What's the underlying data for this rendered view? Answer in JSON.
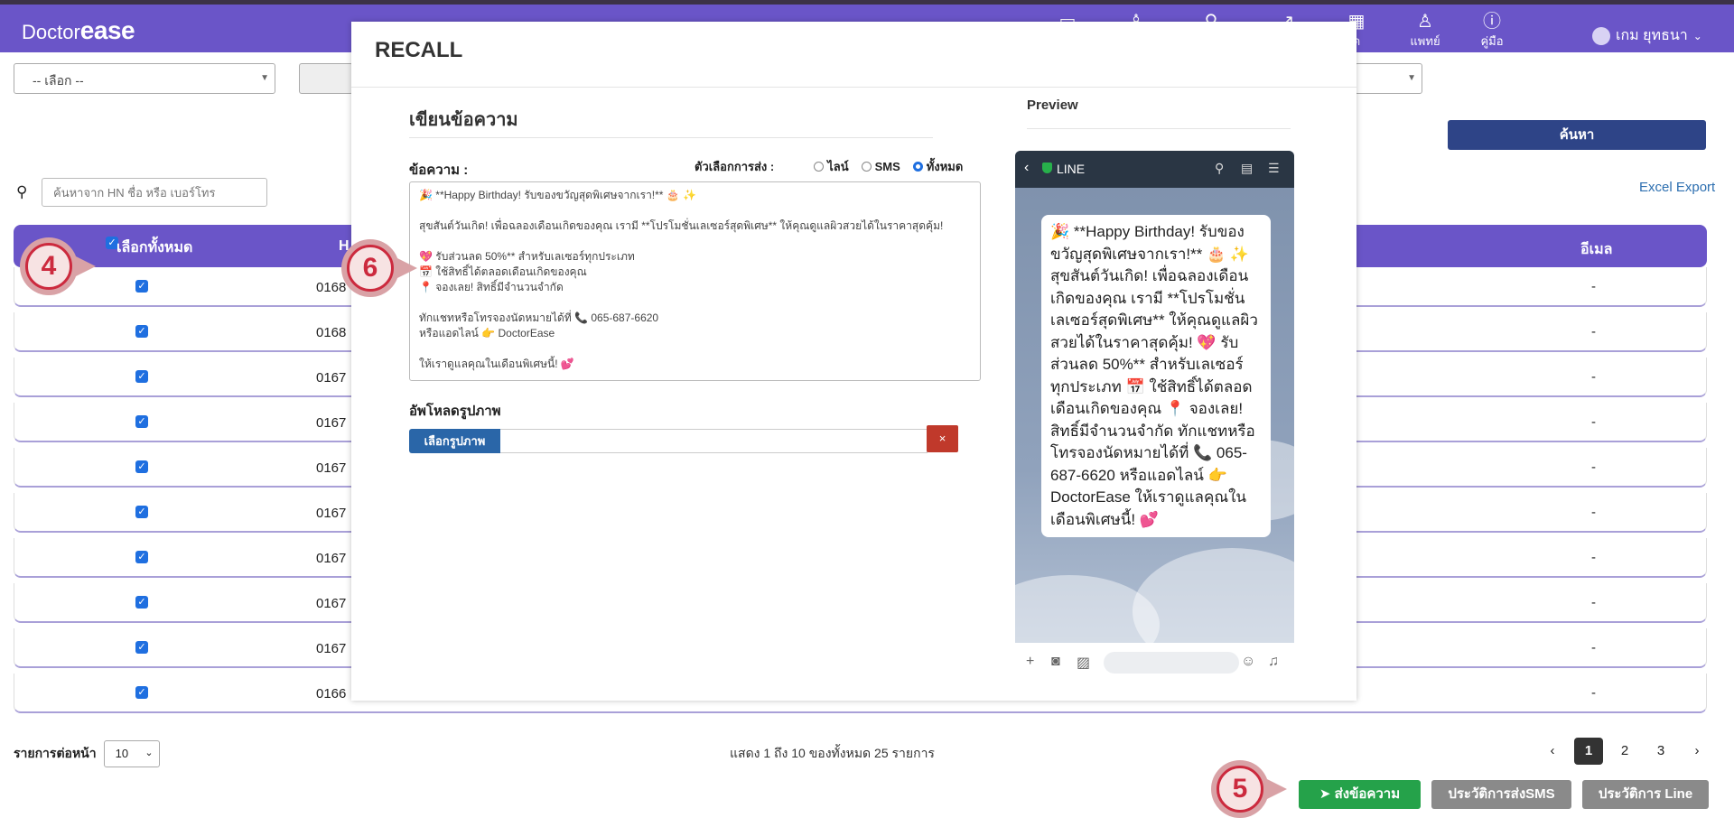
{
  "brand": {
    "prefix": "Doctor",
    "name": "ease"
  },
  "nav": {
    "items": [
      {
        "label": "",
        "icon": "card-icon"
      },
      {
        "label": "",
        "icon": "user-icon"
      },
      {
        "label": "",
        "icon": "search-icon"
      },
      {
        "label": "",
        "icon": "chart-icon"
      },
      {
        "label": "ด",
        "icon": "calendar-icon"
      },
      {
        "label": "แพทย์",
        "icon": "doctor-icon"
      },
      {
        "label": "คู่มือ",
        "icon": "info-icon"
      }
    ],
    "user": "เกม ยุทธนา"
  },
  "filters": {
    "select_placeholder": "-- เลือก --"
  },
  "search": {
    "button": "ค้นหา",
    "placeholder": "ค้นหาจาก HN ชื่อ หรือ เบอร์โทร",
    "excel": "Excel Export"
  },
  "table": {
    "select_all": "เลือกทั้งหมด",
    "col_hn": "H",
    "col_email": "อีเมล",
    "rows": [
      {
        "hn": "0168",
        "email": "-"
      },
      {
        "hn": "0168",
        "email": "-"
      },
      {
        "hn": "0167",
        "email": "-"
      },
      {
        "hn": "0167",
        "email": "-"
      },
      {
        "hn": "0167",
        "email": "-"
      },
      {
        "hn": "0167",
        "email": "-"
      },
      {
        "hn": "0167",
        "email": "-"
      },
      {
        "hn": "0167",
        "email": "-"
      },
      {
        "hn": "0167",
        "email": "-"
      },
      {
        "hn": "0166",
        "email": "-"
      }
    ]
  },
  "footer": {
    "per_page_label": "รายการต่อหน้า",
    "per_page_value": "10",
    "info": "แสดง 1 ถึง 10 ของทั้งหมด 25 รายการ",
    "pages": [
      "1",
      "2",
      "3"
    ],
    "current_page": "1",
    "send_button": "ส่งข้อความ",
    "sms_history": "ประวัติการส่งSMS",
    "line_history": "ประวัติการ Line"
  },
  "modal": {
    "title": "RECALL",
    "compose_title": "เขียนข้อความ",
    "message_label": "ข้อความ :",
    "send_options_label": "ตัวเลือกการส่ง :",
    "options": [
      "ไลน์",
      "SMS",
      "ทั้งหมด"
    ],
    "selected_option": "ทั้งหมด",
    "message_text": "🎉 **Happy Birthday! รับของขวัญสุดพิเศษจากเรา!** 🎂 ✨\n\nสุขสันต์วันเกิด! เพื่อฉลองเดือนเกิดของคุณ เรามี **โปรโมชั่นเลเซอร์สุดพิเศษ** ให้คุณดูแลผิวสวยได้ในราคาสุดคุ้ม!\n\n💖 รับส่วนลด 50%** สำหรับเลเซอร์ทุกประเภท\n📅 ใช้สิทธิ์ได้ตลอดเดือนเกิดของคุณ\n📍 จองเลย! สิทธิ์มีจำนวนจำกัด\n\nทักแชทหรือโทรจองนัดหมายได้ที่ 📞 065-687-6620\nหรือแอดไลน์ 👉 DoctorEase\n\nให้เราดูแลคุณในเดือนพิเศษนี้! 💕",
    "upload_label": "อัพโหลดรูปภาพ",
    "upload_button": "เลือกรูปภาพ",
    "remove_button": "×",
    "preview_label": "Preview",
    "line_header": "LINE",
    "preview_text": "🎉 **Happy Birthday! รับของขวัญสุดพิเศษจากเรา!** 🎂 ✨ สุขสันต์วันเกิด! เพื่อฉลองเดือนเกิดของคุณ เรามี **โปรโมชั่นเลเซอร์สุดพิเศษ** ให้คุณดูแลผิวสวยได้ในราคาสุดคุ้ม! 💖 รับส่วนลด 50%** สำหรับเลเซอร์ทุกประเภท 📅 ใช้สิทธิ์ได้ตลอดเดือนเกิดของคุณ 📍 จองเลย! สิทธิ์มีจำนวนจำกัด ทักแชทหรือโทรจองนัดหมายได้ที่ 📞 065-687-6620 หรือแอดไลน์ 👉 DoctorEase ให้เราดูแลคุณในเดือนพิเศษนี้! 💕"
  },
  "annotations": [
    "4",
    "5",
    "6"
  ],
  "colors": {
    "nav": "#6a55c8",
    "primary": "#2e4487",
    "success": "#25a24a",
    "danger": "#c0392b",
    "callout": "#cc2a3e"
  }
}
